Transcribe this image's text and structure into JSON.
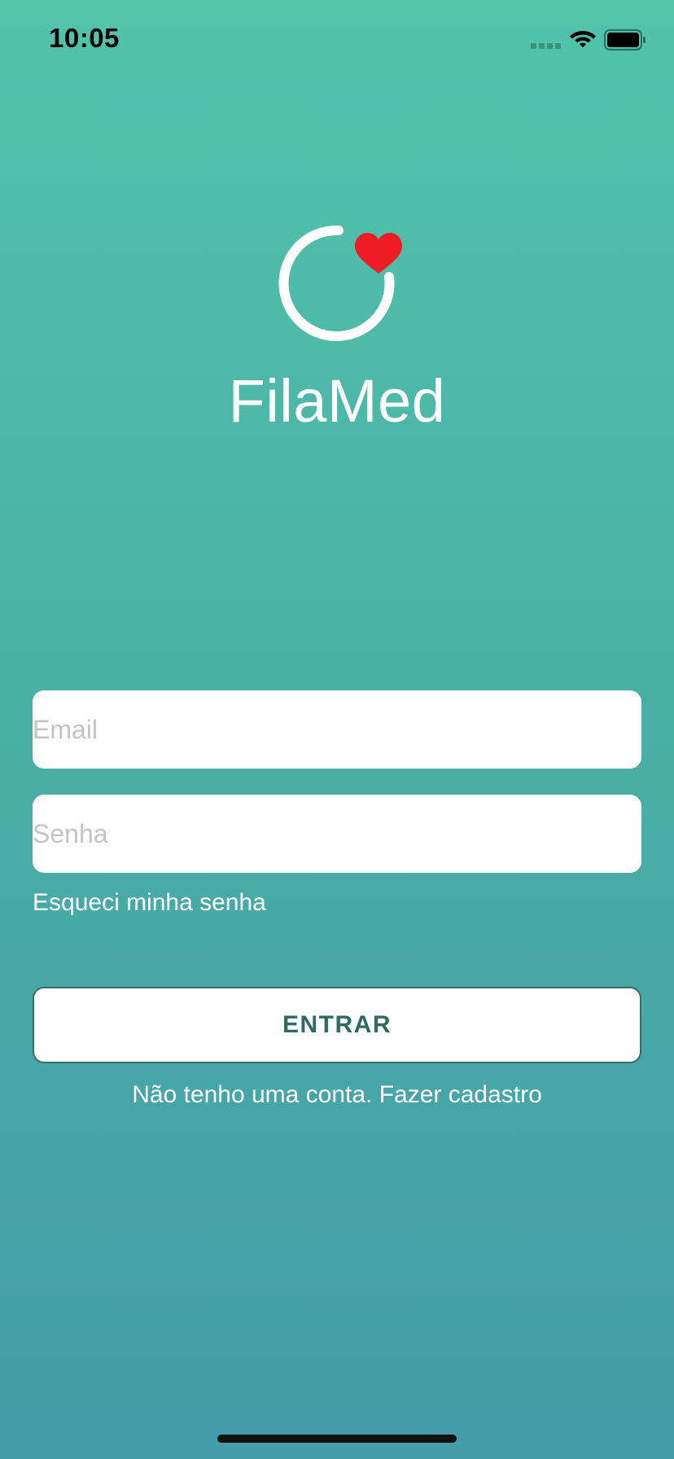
{
  "status_bar": {
    "time": "10:05"
  },
  "brand": {
    "app_name": "FilaMed",
    "logo_ring_color": "#ffffff",
    "logo_heart_color": "#ee1c25"
  },
  "form": {
    "email_placeholder": "Email",
    "password_placeholder": "Senha",
    "forgot_password": "Esqueci minha senha",
    "submit_label": "ENTRAR",
    "signup_prompt": "Não tenho uma conta. Fazer cadastro"
  },
  "colors": {
    "gradient_top": "#51c4aa",
    "gradient_bottom": "#439ca8",
    "button_text": "#2f6b5f"
  }
}
